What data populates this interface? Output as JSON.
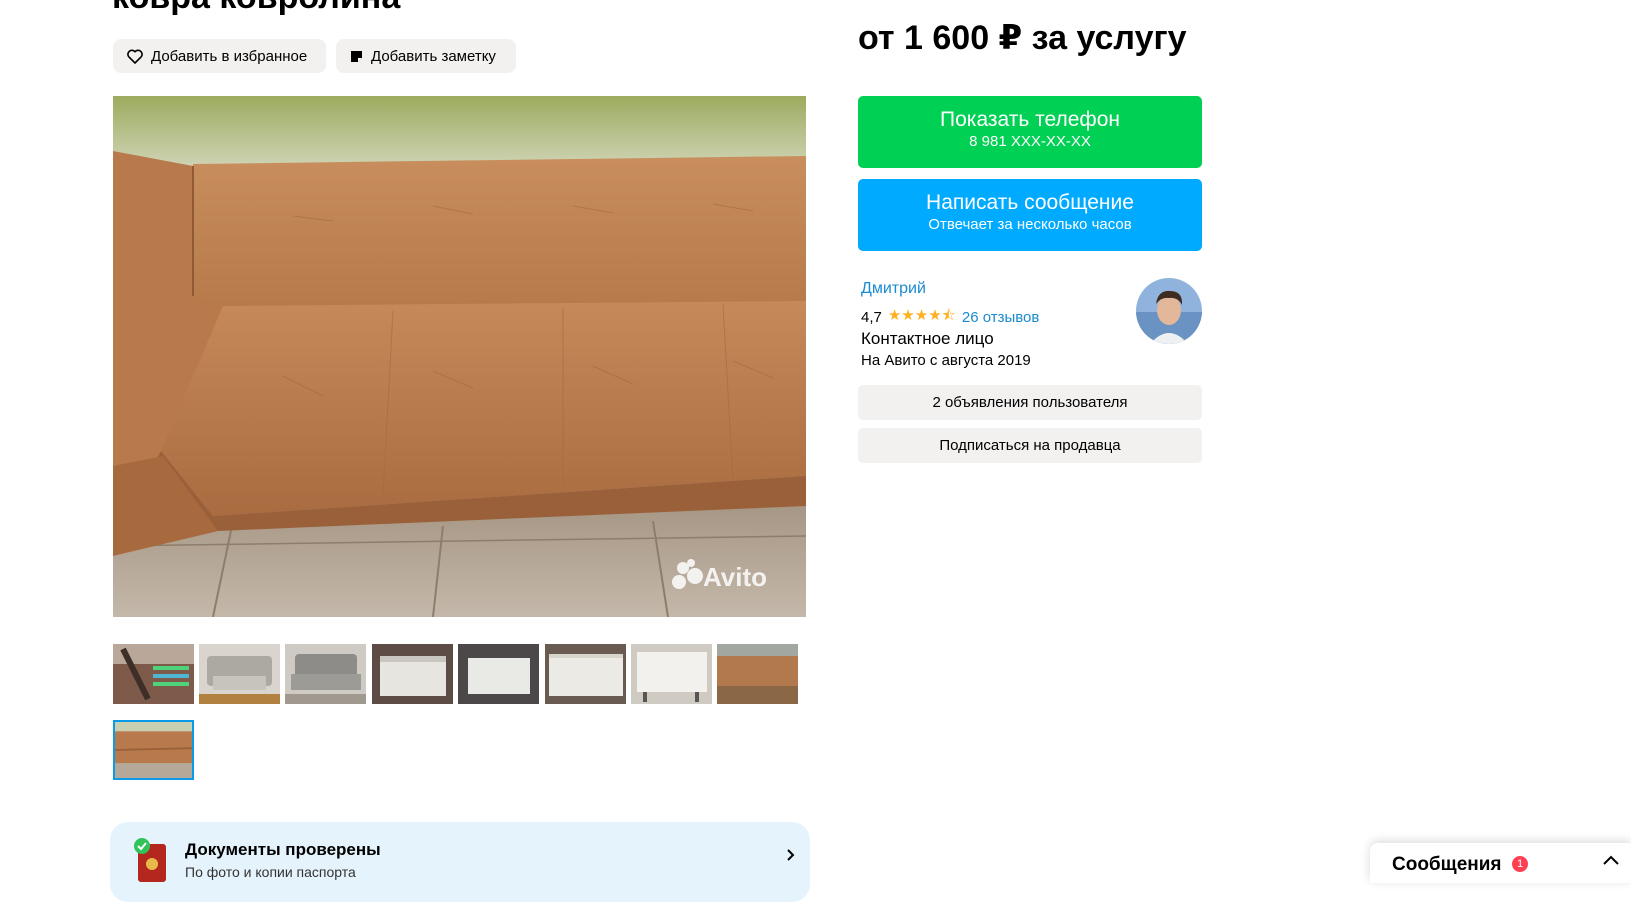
{
  "listing": {
    "title_partial": "ковра ковролина",
    "favorite_label": "Добавить в избранное",
    "note_label": "Добавить заметку",
    "watermark": "Avito"
  },
  "documents": {
    "title": "Документы проверены",
    "subtitle": "По фото и копии паспорта"
  },
  "price": "от 1 600 ₽ за услугу",
  "phone_button": {
    "label": "Показать телефон",
    "sub": "8 981 XXX-XX-XX"
  },
  "message_button": {
    "label": "Написать сообщение",
    "sub": "Отвечает за несколько часов"
  },
  "seller": {
    "name": "Дмитрий",
    "rating": "4,7",
    "stars": "★★★★⯪",
    "reviews": "26 отзывов",
    "role": "Контактное лицо",
    "since": "На Авито с августа 2019"
  },
  "seller_actions": {
    "listings": "2 объявления пользователя",
    "subscribe": "Подписаться на продавца"
  },
  "messages_widget": {
    "label": "Сообщения",
    "count": "1"
  },
  "colors": {
    "green": "#00d154",
    "blue": "#00aaff",
    "link": "#1a8ad1",
    "gray_button": "#f2f1f0",
    "star": "#ffb021"
  }
}
